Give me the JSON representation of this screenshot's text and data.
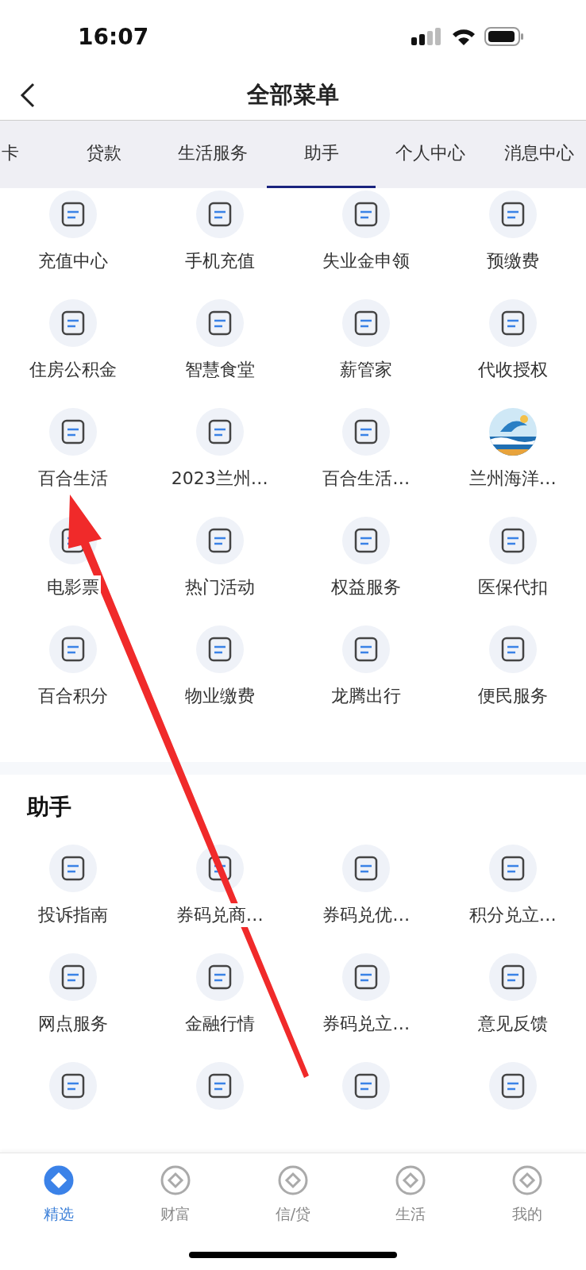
{
  "status_bar": {
    "time": "16:07"
  },
  "header": {
    "title": "全部菜单"
  },
  "tabs": [
    {
      "label": "卡",
      "selected": false
    },
    {
      "label": "贷款",
      "selected": false
    },
    {
      "label": "生活服务",
      "selected": false
    },
    {
      "label": "助手",
      "selected": true
    },
    {
      "label": "个人中心",
      "selected": false
    },
    {
      "label": "消息中心",
      "selected": false
    }
  ],
  "sections": [
    {
      "items": [
        {
          "kind": "service",
          "label": "充值中心"
        },
        {
          "kind": "service",
          "label": "手机充值"
        },
        {
          "kind": "service",
          "label": "失业金申领"
        },
        {
          "kind": "service",
          "label": "预缴费"
        },
        {
          "kind": "service",
          "label": "住房公积金"
        },
        {
          "kind": "service",
          "label": "智慧食堂"
        },
        {
          "kind": "service",
          "label": "薪管家"
        },
        {
          "kind": "service",
          "label": "代收授权"
        },
        {
          "kind": "service",
          "label": "百合生活"
        },
        {
          "kind": "service",
          "label": "2023兰州…"
        },
        {
          "kind": "service",
          "label": "百合生活…"
        },
        {
          "label": "兰州海洋…"
        },
        {
          "kind": "service",
          "label": "电影票"
        },
        {
          "kind": "service",
          "label": "热门活动"
        },
        {
          "kind": "service",
          "label": "权益服务"
        },
        {
          "kind": "service",
          "label": "医保代扣"
        },
        {
          "kind": "service",
          "label": "百合积分"
        },
        {
          "kind": "service",
          "label": "物业缴费"
        },
        {
          "kind": "service",
          "label": "龙腾出行"
        },
        {
          "kind": "service",
          "label": "便民服务"
        }
      ]
    },
    {
      "title": "助手",
      "items": [
        {
          "kind": "service",
          "label": "投诉指南"
        },
        {
          "kind": "service",
          "label": "券码兑商…"
        },
        {
          "kind": "service",
          "label": "券码兑优…"
        },
        {
          "kind": "service",
          "label": "积分兑立…"
        },
        {
          "kind": "service",
          "label": "网点服务"
        },
        {
          "kind": "service",
          "label": "金融行情"
        },
        {
          "kind": "service",
          "label": "券码兑立…"
        },
        {
          "kind": "service",
          "label": "意见反馈"
        },
        {
          "kind": "icon-only"
        },
        {
          "kind": "icon-only"
        },
        {
          "kind": "icon-only"
        },
        {
          "kind": "icon-only"
        }
      ]
    }
  ],
  "bottom_nav": [
    {
      "label": "精选",
      "selected": true
    },
    {
      "label": "财富",
      "selected": false
    },
    {
      "label": "信/贷",
      "selected": false
    },
    {
      "label": "生活",
      "selected": false
    },
    {
      "label": "我的",
      "selected": false
    }
  ]
}
